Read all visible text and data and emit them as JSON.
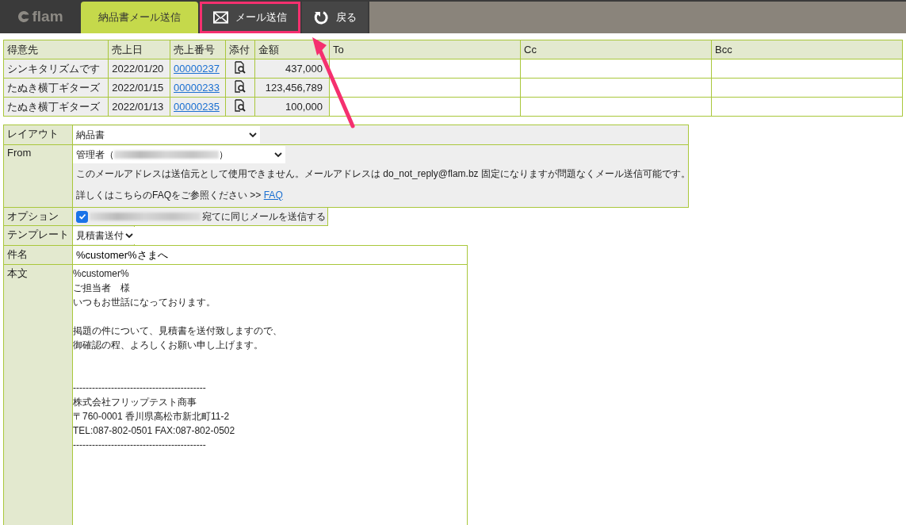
{
  "app": {
    "logo": "flam"
  },
  "toolbar": [
    {
      "kind": "tab",
      "label": "納品書メール送信",
      "selected": true,
      "annotated": false
    },
    {
      "kind": "mail",
      "label": "メール送信",
      "selected": false,
      "annotated": true
    },
    {
      "kind": "back",
      "label": "戻る",
      "selected": false,
      "annotated": false
    }
  ],
  "table": {
    "columns": [
      "得意先",
      "売上日",
      "売上番号",
      "添付",
      "金額",
      "To",
      "Cc",
      "Bcc"
    ],
    "rows": [
      {
        "customer": "シンキタリズムです",
        "date": "2022/01/20",
        "number": "00000237",
        "amount": "437,000"
      },
      {
        "customer": "たぬき横丁ギターズ",
        "date": "2022/01/15",
        "number": "00000233",
        "amount": "123,456,789"
      },
      {
        "customer": "たぬき横丁ギターズ",
        "date": "2022/01/13",
        "number": "00000235",
        "amount": "100,000"
      }
    ]
  },
  "form": {
    "layout": {
      "label": "レイアウト",
      "value": "納品書"
    },
    "from": {
      "label": "From",
      "value_prefix": "管理者（",
      "value_suffix": "）",
      "notice": "このメールアドレスは送信元として使用できません。メールアドレスは do_not_reply@flam.bz 固定になりますが問題なくメール送信可能です。",
      "faq_text": "詳しくはこちらのFAQをご参照ください >>",
      "faq_link": "FAQ"
    },
    "option": {
      "label": "オプション",
      "checked": true,
      "text": "宛てに同じメールを送信する"
    },
    "template": {
      "label": "テンプレート",
      "value": "見積書送付"
    },
    "subject": {
      "label": "件名",
      "value": "%customer%さまへ"
    },
    "body": {
      "label": "本文",
      "blocks": [
        {
          "kind": "greeting",
          "lines": [
            "%customer%",
            "ご担当者　様",
            "いつもお世話になっております。"
          ]
        },
        {
          "kind": "message",
          "lines": [
            "掲題の件について、見積書を送付致しますので、",
            "御確認の程、よろしくお願い申し上げます。"
          ]
        },
        {
          "kind": "signature",
          "lines": [
            "------------------------------------------",
            "株式会社フリップテスト商事",
            "〒760-0001 香川県高松市新北町11-2",
            "TEL:087-802-0501 FAX:087-802-0502",
            "------------------------------------------"
          ]
        }
      ]
    }
  }
}
